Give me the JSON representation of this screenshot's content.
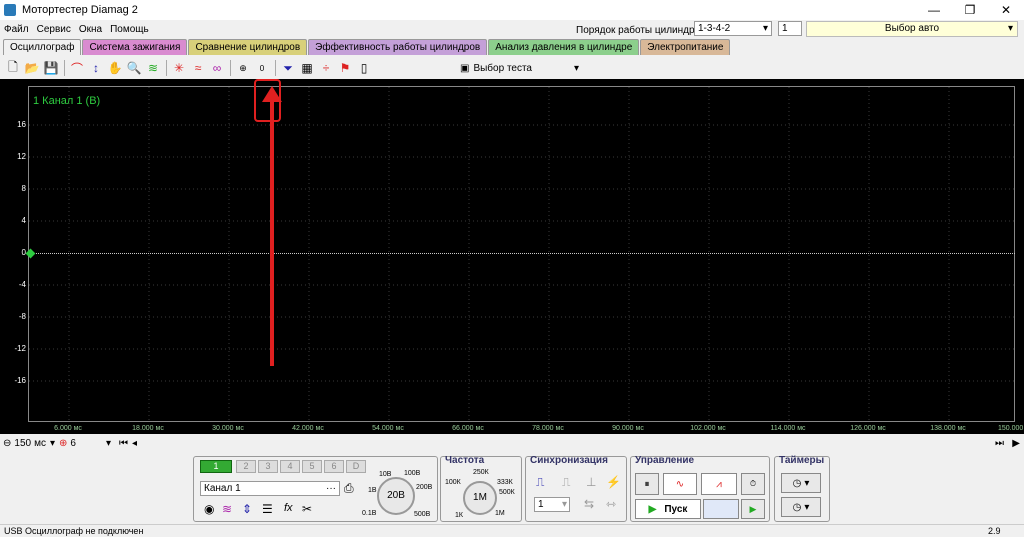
{
  "window": {
    "title": "Мотортестер Diamag 2",
    "min": "—",
    "max": "❐",
    "close": "✕"
  },
  "menu": [
    "Файл",
    "Сервис",
    "Окна",
    "Помощь"
  ],
  "cylinders": {
    "label": "Порядок работы цилиндров",
    "order": "1-3-4-2",
    "count": "1",
    "auto": "Выбор авто"
  },
  "tabs": [
    {
      "label": "Осциллограф",
      "color": "#f0f0f0"
    },
    {
      "label": "Система зажигания",
      "color": "#d98bd0"
    },
    {
      "label": "Сравнение цилиндров",
      "color": "#d8d07a"
    },
    {
      "label": "Эффективность работы цилиндров",
      "color": "#c4a0d8"
    },
    {
      "label": "Анализ давления в цилиндре",
      "color": "#8ccf8c"
    },
    {
      "label": "Электропитание",
      "color": "#d8b898"
    }
  ],
  "toolbar": {
    "test_select": "Выбор теста",
    "auto_zero": "0"
  },
  "scope": {
    "channel_label": "1 Канал 1 (В)",
    "yticks": [
      "16",
      "12",
      "8",
      "4",
      "0",
      "-4",
      "-8",
      "-12",
      "-16"
    ],
    "xticks": [
      "6.000 мс",
      "18.000 мс",
      "30.000 мс",
      "42.000 мс",
      "54.000 мс",
      "66.000 мс",
      "78.000 мс",
      "90.000 мс",
      "102.000 мс",
      "114.000 мс",
      "126.000 мс",
      "138.000 мс",
      "150.000"
    ]
  },
  "bottom": {
    "timebase": "150",
    "unit": "мс",
    "channel_num": "6"
  },
  "channels": {
    "buttons": [
      "1",
      "2",
      "3",
      "4",
      "5",
      "6",
      "D"
    ],
    "name": "Канал 1",
    "dots": "···"
  },
  "range": {
    "title": "",
    "value": "20В",
    "labels": [
      "10В",
      "100В",
      "1В",
      "200В",
      "0.1В",
      "500В"
    ]
  },
  "freq": {
    "title": "Частота",
    "value": "1М",
    "labels": [
      "250К",
      "100К",
      "333К",
      "500К",
      "1К",
      "1М"
    ]
  },
  "sync": {
    "title": "Синхронизация",
    "value": "1"
  },
  "control": {
    "title": "Управление",
    "start": "Пуск"
  },
  "timers": {
    "title": "Таймеры"
  },
  "status": {
    "text": "USB Осциллограф не подключен",
    "version": "2.9"
  }
}
